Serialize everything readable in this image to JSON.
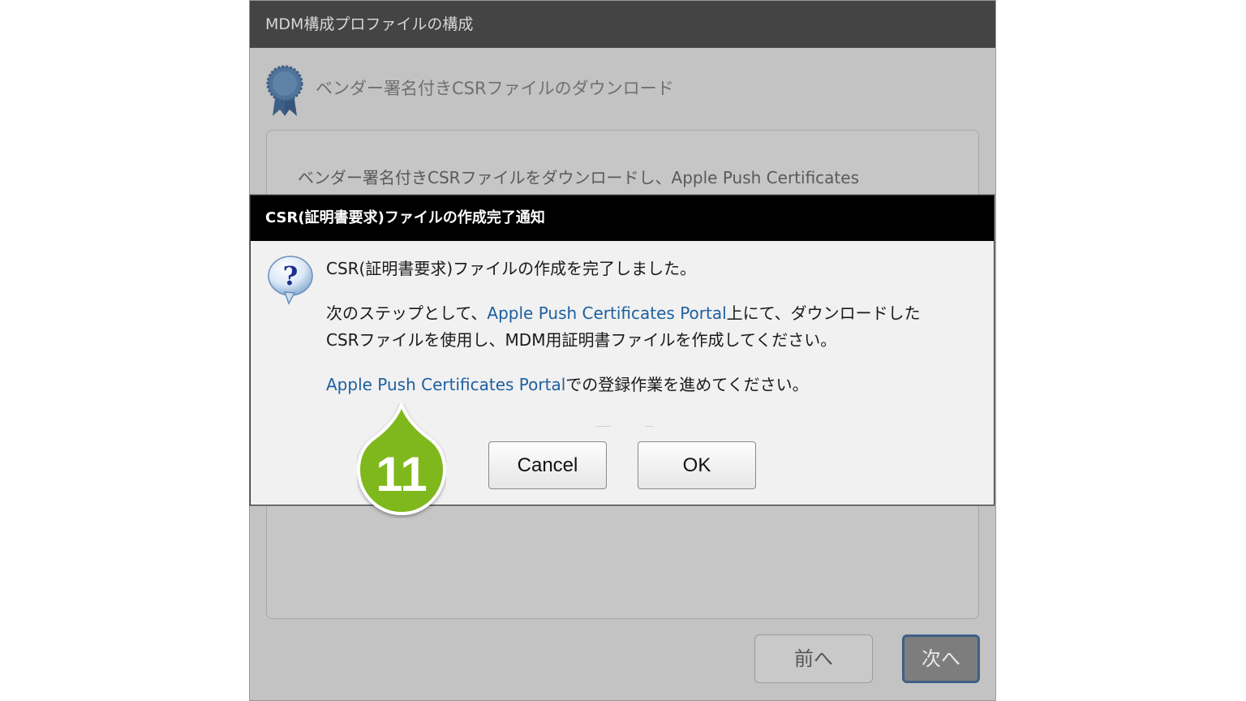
{
  "wizard": {
    "title": "MDM構成プロファイルの構成",
    "step_title": "ベンダー署名付きCSRファイルのダウンロード",
    "panel_text": "ベンダー署名付きCSRファイルをダウンロードし、Apple Push Certificates",
    "prev_label": "前へ",
    "next_label": "次へ",
    "step_icon": "ribbon-badge-icon"
  },
  "dialog": {
    "title": "CSR(証明書要求)ファイルの作成完了通知",
    "icon": "question-balloon-icon",
    "line1": "CSR(証明書要求)ファイルの作成を完了しました。",
    "para2_prefix": "次のステップとして、",
    "para2_link": "Apple Push Certificates Portal",
    "para2_suffix": "上にて、ダウンロードした",
    "para2_line2": "CSRファイルを使用し、MDM用証明書ファイルを作成してください。",
    "para3_link": "Apple Push Certificates Portal",
    "para3_suffix": "での登録作業を進めてください。",
    "cancel_label": "Cancel",
    "ok_label": "OK"
  },
  "step_marker": {
    "label": "11",
    "color": "#7fb81c"
  },
  "colors": {
    "link": "#1d5f9e",
    "dialog_title_bg": "#000000",
    "wizard_title_bg": "#444444",
    "next_border": "#3f5f86"
  }
}
